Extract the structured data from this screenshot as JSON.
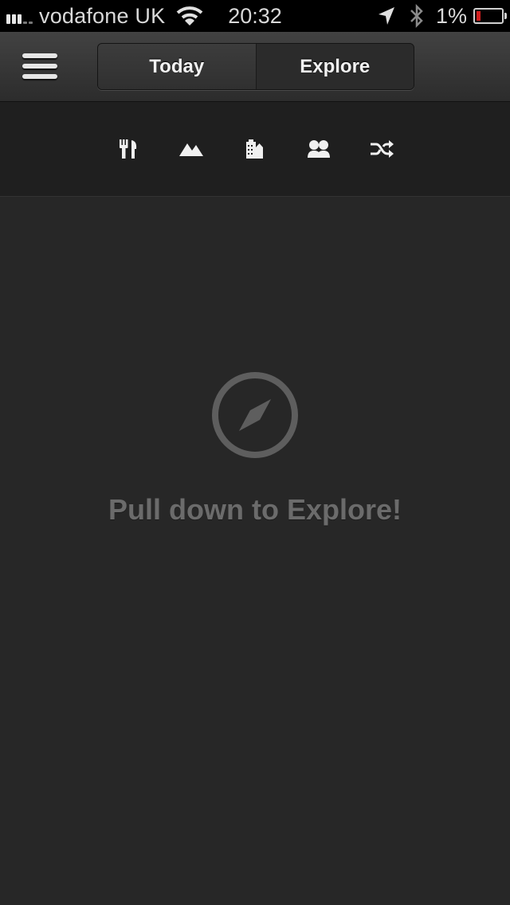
{
  "status_bar": {
    "carrier": "vodafone UK",
    "time": "20:32",
    "battery_percent": "1%"
  },
  "nav": {
    "segments": [
      {
        "label": "Today"
      },
      {
        "label": "Explore"
      }
    ]
  },
  "categories": [
    {
      "icon": "food-utensils-icon"
    },
    {
      "icon": "mountains-icon"
    },
    {
      "icon": "buildings-icon"
    },
    {
      "icon": "people-icon"
    },
    {
      "icon": "shuffle-icon"
    }
  ],
  "empty_state": {
    "icon": "compass-icon",
    "message": "Pull down to Explore!"
  },
  "colors": {
    "battery_low": "#d21e1e",
    "background": "#272727",
    "empty_text": "#6b6b6b"
  }
}
